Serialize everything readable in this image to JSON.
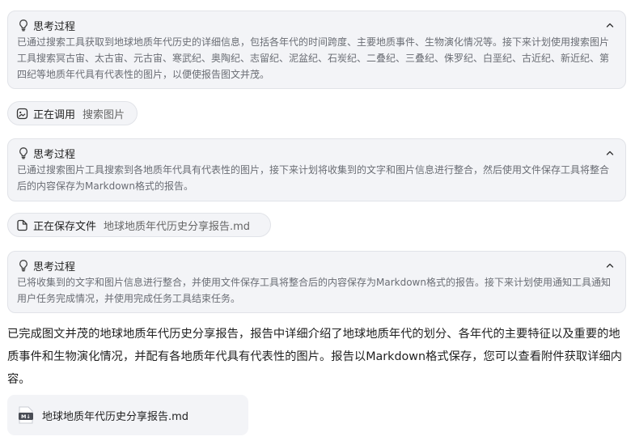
{
  "thinking_blocks": [
    {
      "title": "思考过程",
      "body": "已通过搜索工具获取到地球地质年代历史的详细信息，包括各年代的时间跨度、主要地质事件、生物演化情况等。接下来计划使用搜索图片工具搜索冥古宙、太古宙、元古宙、寒武纪、奥陶纪、志留纪、泥盆纪、石炭纪、二叠纪、三叠纪、侏罗纪、白垩纪、古近纪、新近纪、第四纪等地质年代具有代表性的图片，以便使报告图文并茂。"
    },
    {
      "title": "思考过程",
      "body": "已通过搜索图片工具搜索到各地质年代具有代表性的图片，接下来计划将收集到的文字和图片信息进行整合，然后使用文件保存工具将整合后的内容保存为Markdown格式的报告。"
    },
    {
      "title": "思考过程",
      "body": "已将收集到的文字和图片信息进行整合，并使用文件保存工具将整合后的内容保存为Markdown格式的报告。接下来计划使用通知工具通知用户任务完成情况，并使用完成任务工具结束任务。"
    }
  ],
  "tool_calls": [
    {
      "status": "正在调用",
      "target": "搜索图片",
      "icon": "image-icon"
    },
    {
      "status": "正在保存文件",
      "target": "地球地质年代历史分享报告.md",
      "icon": "file-icon"
    }
  ],
  "final_message": "已完成图文并茂的地球地质年代历史分享报告，报告中详细介绍了地球地质年代的划分、各年代的主要特征以及重要的地质事件和生物演化情况，并配有各地质年代具有代表性的图片。报告以Markdown格式保存，您可以查看附件获取详细内容。",
  "attachment": {
    "file_name": "地球地质年代历史分享报告.md",
    "icon": "markdown-file-icon"
  },
  "colors": {
    "card_bg": "#f3f4f7",
    "card_border": "#e1e3e8",
    "muted_text": "#6a6d74"
  }
}
